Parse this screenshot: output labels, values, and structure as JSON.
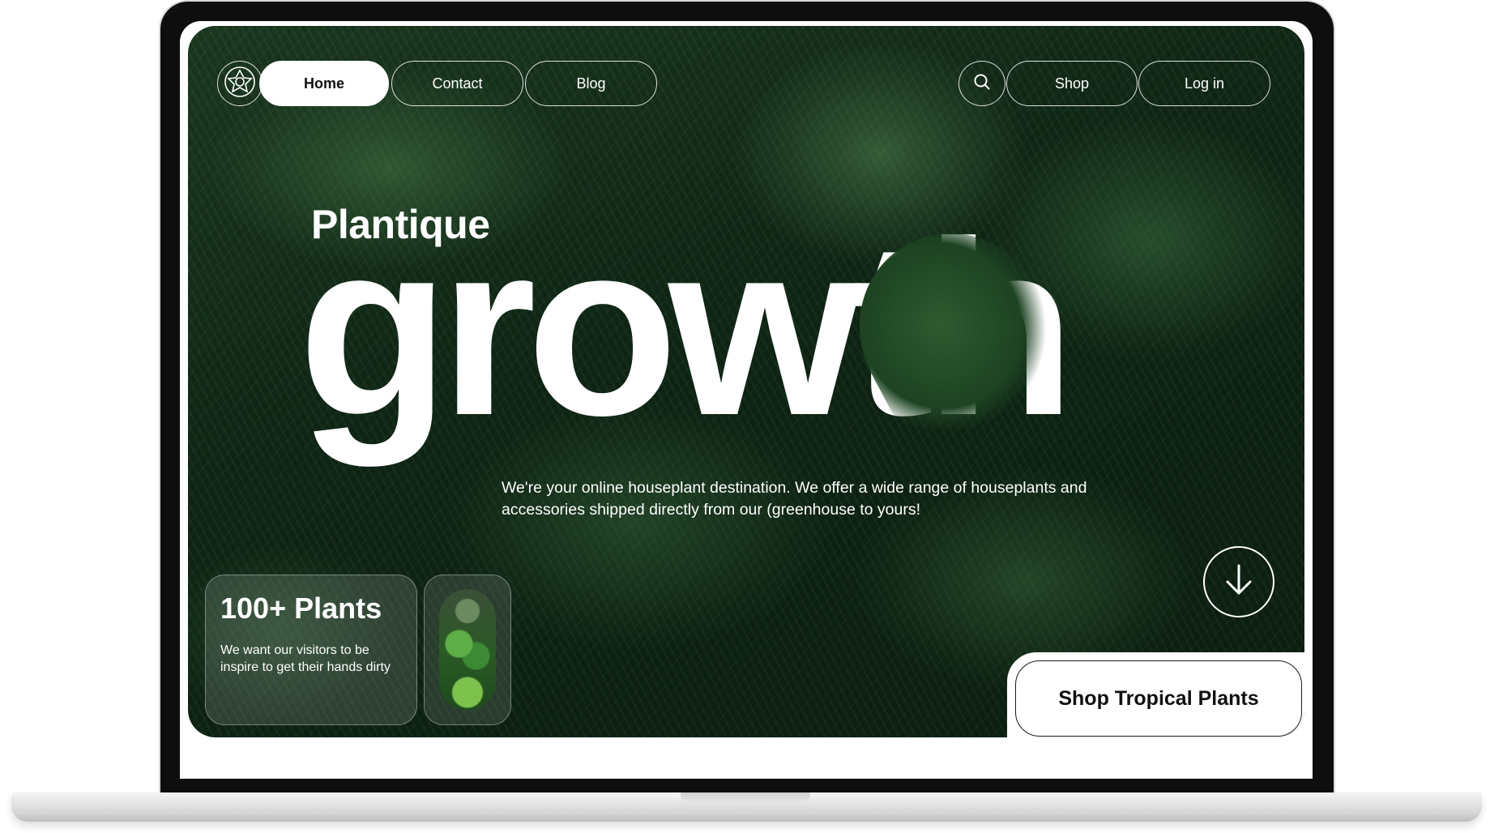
{
  "nav": {
    "logo_icon": "flower-badge-icon",
    "links": [
      "Home",
      "Contact",
      "Blog"
    ],
    "active": "Home",
    "search_icon": "search-icon",
    "shop_label": "Shop",
    "login_label": "Log in"
  },
  "hero": {
    "brand": "Plantique",
    "headline": "growth",
    "tagline": "We're your online houseplant destination. We offer a wide range of houseplants and accessories shipped directly from our (greenhouse to yours!",
    "scroll_icon": "arrow-down-icon"
  },
  "stat_card": {
    "title": "100+ Plants",
    "description": "We want our visitors to be inspire to get their hands dirty"
  },
  "cta": {
    "label": "Shop Tropical Plants"
  },
  "colors": {
    "hero_green": "#0f2615",
    "text_on_hero": "#ffffff",
    "cta_text": "#111111"
  }
}
